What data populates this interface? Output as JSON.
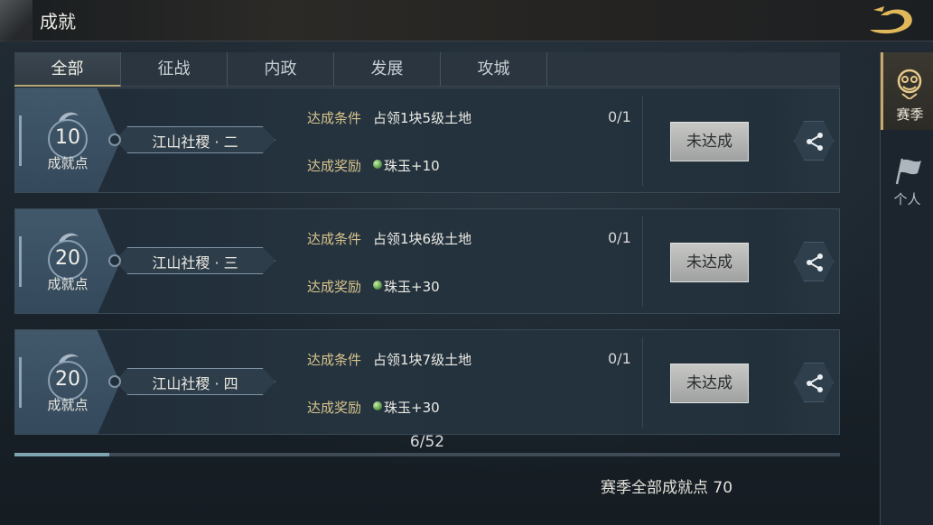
{
  "header": {
    "title": "成就"
  },
  "tabs": [
    {
      "label": "全部",
      "active": true
    },
    {
      "label": "征战",
      "active": false
    },
    {
      "label": "内政",
      "active": false
    },
    {
      "label": "发展",
      "active": false
    },
    {
      "label": "攻城",
      "active": false
    }
  ],
  "achievements": [
    {
      "points": "10",
      "points_label": "成就点",
      "name": "江山社稷 · 二",
      "condition_label": "达成条件",
      "condition": "占领1块5级土地",
      "progress": "0/1",
      "reward_label": "达成奖励",
      "reward": "珠玉+10",
      "status": "未达成"
    },
    {
      "points": "20",
      "points_label": "成就点",
      "name": "江山社稷 · 三",
      "condition_label": "达成条件",
      "condition": "占领1块6级土地",
      "progress": "0/1",
      "reward_label": "达成奖励",
      "reward": "珠玉+30",
      "status": "未达成"
    },
    {
      "points": "20",
      "points_label": "成就点",
      "name": "江山社稷 · 四",
      "condition_label": "达成条件",
      "condition": "占领1块7级土地",
      "progress": "0/1",
      "reward_label": "达成奖励",
      "reward": "珠玉+30",
      "status": "未达成"
    }
  ],
  "pager": {
    "text": "6/52",
    "scroll_fraction": 0.115
  },
  "total": {
    "text": "赛季全部成就点 70"
  },
  "rail": [
    {
      "label": "赛季",
      "active": true,
      "icon": "season-icon"
    },
    {
      "label": "个人",
      "active": false,
      "icon": "flag-icon"
    }
  ],
  "colors": {
    "accent_gold": "#d7c38a",
    "button_grey": "#b4b5b3",
    "scroll_thumb": "#7fa5b2"
  }
}
